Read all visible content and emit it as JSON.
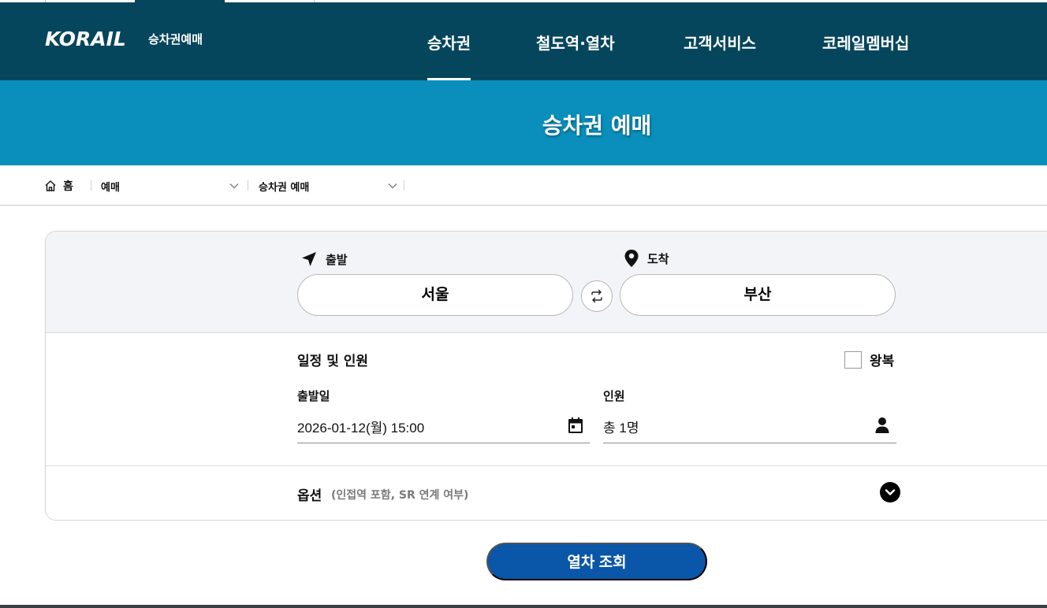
{
  "colors": {
    "header_bg": "#06465d",
    "banner_bg": "#0a8fbc",
    "panel_top_bg": "#f3f4f7",
    "search_button_bg": "#0a56a8"
  },
  "logo": {
    "wordmark": "KORAIL",
    "subtitle": "승차권예매"
  },
  "nav": {
    "items": [
      {
        "label": "승차권",
        "active": true
      },
      {
        "label": "철도역·열차",
        "active": false
      },
      {
        "label": "고객서비스",
        "active": false
      },
      {
        "label": "코레일멤버십",
        "active": false
      }
    ]
  },
  "banner": {
    "title": "승차권 예매"
  },
  "breadcrumb": {
    "home": "홈",
    "level1": "예매",
    "level2": "승차권 예매"
  },
  "route": {
    "departure_label": "출발",
    "departure_value": "서울",
    "arrival_label": "도착",
    "arrival_value": "부산",
    "swap_icon": "swap-arrows-icon"
  },
  "schedule": {
    "title": "일정 및 인원",
    "roundtrip_label": "왕복",
    "roundtrip_checked": false,
    "date_label": "출발일",
    "date_value": "2026-01-12(월) 15:00",
    "date_icon": "calendar-icon",
    "passenger_label": "인원",
    "passenger_value": "총 1명",
    "passenger_icon": "person-icon"
  },
  "options": {
    "title": "옵션",
    "desc": "(인접역 포함, SR 연계 여부)",
    "toggle_icon": "chevron-down-circle-icon"
  },
  "search_button": {
    "label": "열차 조회"
  }
}
